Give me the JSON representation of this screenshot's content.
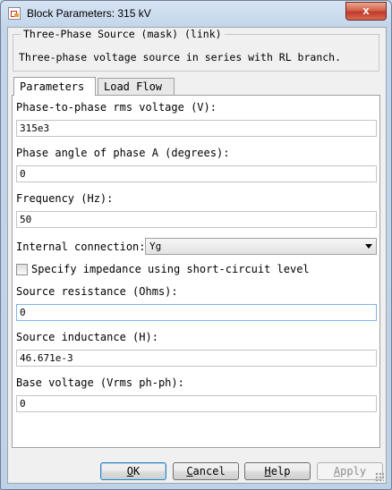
{
  "window": {
    "title": "Block Parameters: 315 kV",
    "close_glyph": "x"
  },
  "mask": {
    "title": "Three-Phase Source (mask) (link)",
    "description": "Three-phase voltage source in series with RL branch."
  },
  "tabs": [
    {
      "label": "Parameters",
      "active": true
    },
    {
      "label": "Load Flow",
      "active": false
    }
  ],
  "params": {
    "phase_voltage": {
      "label": "Phase-to-phase rms voltage (V):",
      "value": "315e3"
    },
    "phase_angle": {
      "label": "Phase angle of phase A (degrees):",
      "value": "0"
    },
    "frequency": {
      "label": "Frequency (Hz):",
      "value": "50"
    },
    "internal_connection": {
      "label": "Internal connection:",
      "value": "Yg"
    },
    "specify_impedance": {
      "label": "Specify impedance using short-circuit level",
      "checked": false
    },
    "source_resistance": {
      "label": "Source resistance (Ohms):",
      "value": "0"
    },
    "source_inductance": {
      "label": "Source inductance (H):",
      "value": "46.671e-3"
    },
    "base_voltage": {
      "label": "Base voltage (Vrms ph-ph):",
      "value": "0"
    }
  },
  "buttons": {
    "ok": {
      "first": "O",
      "rest": "K"
    },
    "cancel": {
      "first": "C",
      "rest": "ancel"
    },
    "help": {
      "first": "H",
      "rest": "elp"
    },
    "apply": {
      "first": "A",
      "rest": "pply"
    }
  },
  "colors": {
    "accent_focus": "#7eb4ea",
    "close_red": "#c0392b",
    "frame_blue": "#c3d5ea"
  }
}
